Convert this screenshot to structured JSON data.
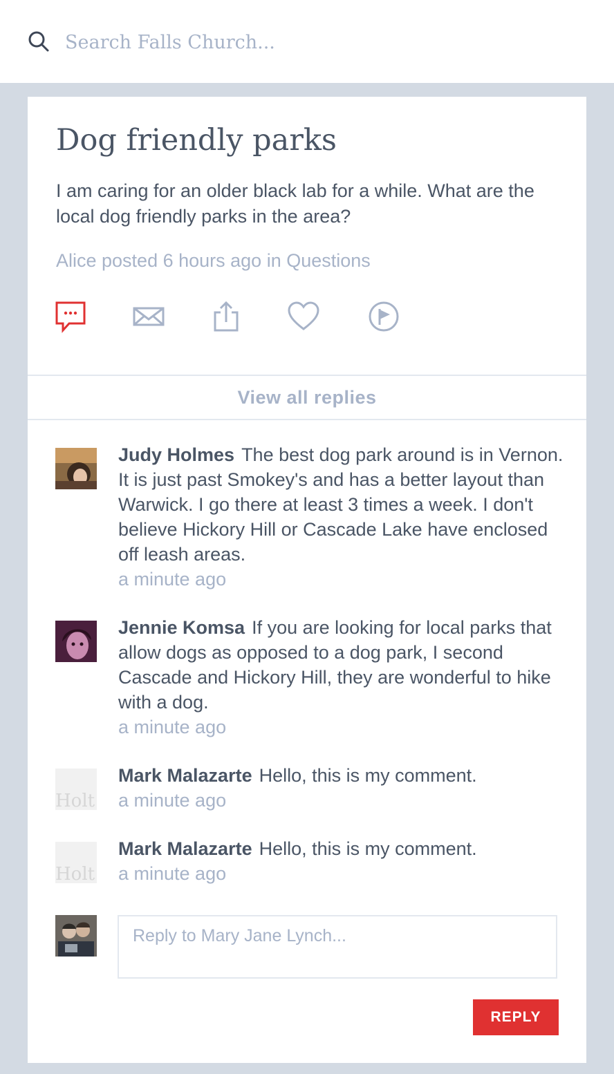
{
  "search": {
    "placeholder": "Search Falls Church..."
  },
  "post": {
    "title": "Dog friendly parks",
    "body": "I am caring for an older black lab for a while. What are the local dog friendly parks in the area?",
    "meta": "Alice posted 6 hours ago in Questions"
  },
  "actions": [
    {
      "icon": "comment-icon",
      "color": "#e03131"
    },
    {
      "icon": "mail-icon",
      "color": "#a7b3c8"
    },
    {
      "icon": "share-icon",
      "color": "#a7b3c8"
    },
    {
      "icon": "heart-icon",
      "color": "#a7b3c8"
    },
    {
      "icon": "flag-icon",
      "color": "#a7b3c8"
    }
  ],
  "view_replies_label": "View all replies",
  "comments": [
    {
      "author": "Judy Holmes",
      "text": "The best dog park around is in Vernon. It is just past Smokey's and has a better layout than Warwick. I go there at least 3 times a week. I don't believe Hickory Hill or Cascade Lake have enclosed off leash areas.",
      "time": "a minute ago"
    },
    {
      "author": "Jennie Komsa",
      "text": "If you are looking for local parks that allow dogs as opposed to a dog park, I second Cascade and Hickory Hill, they are wonderful to hike with a dog.",
      "time": "a minute ago"
    },
    {
      "author": "Mark Malazarte",
      "text": "Hello, this is my comment.",
      "time": "a minute ago",
      "avatar_placeholder": "Holt"
    },
    {
      "author": "Mark Malazarte",
      "text": "Hello, this is my comment.",
      "time": "a minute ago",
      "avatar_placeholder": "Holt"
    }
  ],
  "reply": {
    "placeholder": "Reply to Mary Jane Lynch...",
    "button_label": "REPLY"
  },
  "colors": {
    "accent": "#e03131",
    "muted": "#a7b3c8",
    "text": "#4a5565",
    "background": "#d3dae3"
  }
}
